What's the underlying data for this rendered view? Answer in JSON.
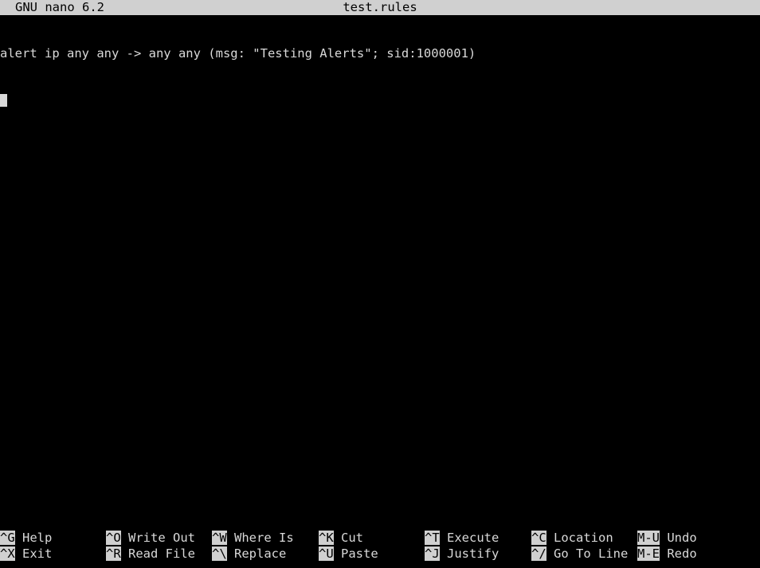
{
  "titlebar": {
    "app": "GNU nano 6.2",
    "filename": "test.rules"
  },
  "editor": {
    "lines": [
      "alert ip any any -> any any (msg: \"Testing Alerts\"; sid:1000001)",
      ""
    ]
  },
  "shortcuts": {
    "row1": [
      {
        "key": "^G",
        "label": "Help"
      },
      {
        "key": "^O",
        "label": "Write Out"
      },
      {
        "key": "^W",
        "label": "Where Is"
      },
      {
        "key": "^K",
        "label": "Cut"
      },
      {
        "key": "^T",
        "label": "Execute"
      },
      {
        "key": "^C",
        "label": "Location"
      },
      {
        "key": "M-U",
        "label": "Undo"
      }
    ],
    "row2": [
      {
        "key": "^X",
        "label": "Exit"
      },
      {
        "key": "^R",
        "label": "Read File"
      },
      {
        "key": "^\\",
        "label": "Replace"
      },
      {
        "key": "^U",
        "label": "Paste"
      },
      {
        "key": "^J",
        "label": "Justify"
      },
      {
        "key": "^/",
        "label": "Go To Line"
      },
      {
        "key": "M-E",
        "label": "Redo"
      }
    ]
  },
  "colors": {
    "background": "#000000",
    "foreground": "#d9d9d9",
    "inverse_bg": "#d0d0d0",
    "inverse_fg": "#000000"
  }
}
